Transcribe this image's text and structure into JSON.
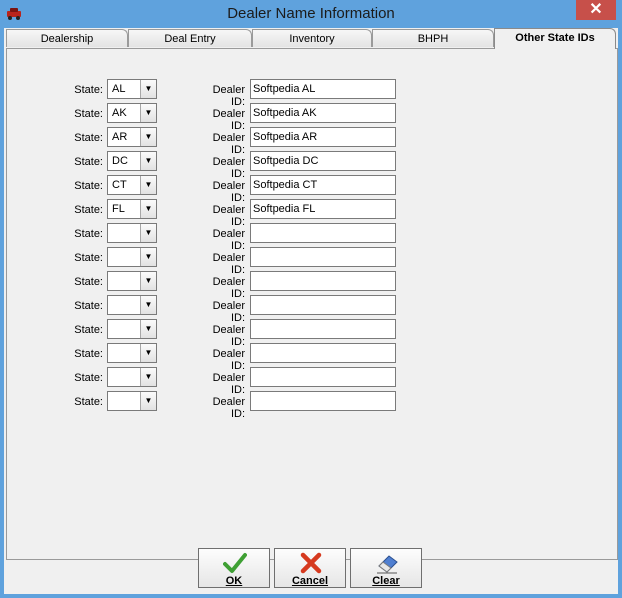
{
  "window": {
    "title": "Dealer Name Information",
    "close_label": "✕"
  },
  "tabs": [
    {
      "label": "Dealership",
      "active": false
    },
    {
      "label": "Deal Entry",
      "active": false
    },
    {
      "label": "Inventory",
      "active": false
    },
    {
      "label": "BHPH",
      "active": false
    },
    {
      "label": "Other State IDs",
      "active": true
    }
  ],
  "labels": {
    "state": "State:",
    "dealer_id": "Dealer ID:"
  },
  "rows": [
    {
      "state": "AL",
      "dealer_id": "Softpedia AL"
    },
    {
      "state": "AK",
      "dealer_id": "Softpedia AK"
    },
    {
      "state": "AR",
      "dealer_id": "Softpedia AR"
    },
    {
      "state": "DC",
      "dealer_id": "Softpedia DC"
    },
    {
      "state": "CT",
      "dealer_id": "Softpedia CT"
    },
    {
      "state": "FL",
      "dealer_id": "Softpedia FL"
    },
    {
      "state": "",
      "dealer_id": ""
    },
    {
      "state": "",
      "dealer_id": ""
    },
    {
      "state": "",
      "dealer_id": ""
    },
    {
      "state": "",
      "dealer_id": ""
    },
    {
      "state": "",
      "dealer_id": ""
    },
    {
      "state": "",
      "dealer_id": ""
    },
    {
      "state": "",
      "dealer_id": ""
    },
    {
      "state": "",
      "dealer_id": ""
    }
  ],
  "buttons": {
    "ok": "OK",
    "cancel": "Cancel",
    "clear": "Clear"
  },
  "icons": {
    "ok": "check-icon",
    "cancel": "x-icon",
    "clear": "eraser-icon",
    "app": "car-icon"
  },
  "colors": {
    "titlebar": "#5fa2dd",
    "close": "#c7504a",
    "ok_check": "#3fa034",
    "cancel_x": "#d63a1f"
  }
}
